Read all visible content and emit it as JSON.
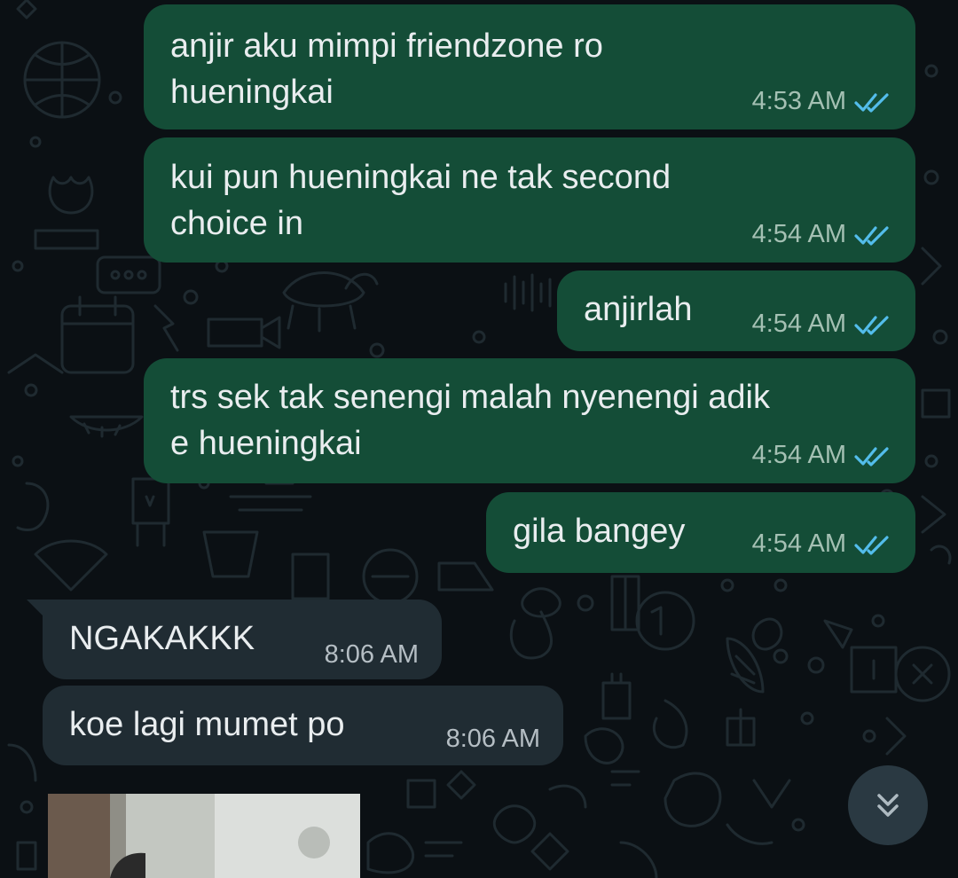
{
  "colors": {
    "background": "#0b1014",
    "outgoing_bubble": "#144d37",
    "incoming_bubble": "#202c33",
    "read_ticks": "#53bdeb",
    "text": "#e9edef"
  },
  "messages": [
    {
      "direction": "outgoing",
      "lines": [
        "anjir aku mimpi friendzone ro",
        "hueningkai"
      ],
      "time": "4:53 AM",
      "status": "read-double-check-icon"
    },
    {
      "direction": "outgoing",
      "lines": [
        "kui pun hueningkai ne tak second",
        "choice in"
      ],
      "time": "4:54 AM",
      "status": "read-double-check-icon"
    },
    {
      "direction": "outgoing",
      "lines": [
        "anjirlah"
      ],
      "time": "4:54 AM",
      "status": "read-double-check-icon"
    },
    {
      "direction": "outgoing",
      "lines": [
        "trs sek tak senengi malah nyenengi adik",
        "e hueningkai"
      ],
      "time": "4:54 AM",
      "status": "read-double-check-icon"
    },
    {
      "direction": "outgoing",
      "lines": [
        "gila bangey"
      ],
      "time": "4:54 AM",
      "status": "read-double-check-icon"
    },
    {
      "direction": "incoming",
      "lines": [
        "NGAKAKKK"
      ],
      "time": "8:06 AM"
    },
    {
      "direction": "incoming",
      "lines": [
        "koe lagi mumet po"
      ],
      "time": "8:06 AM"
    }
  ],
  "incoming_media": {
    "type": "image",
    "content": "photo-thumbnail"
  },
  "scroll_button": {
    "icon": "double-chevron-down-icon"
  }
}
